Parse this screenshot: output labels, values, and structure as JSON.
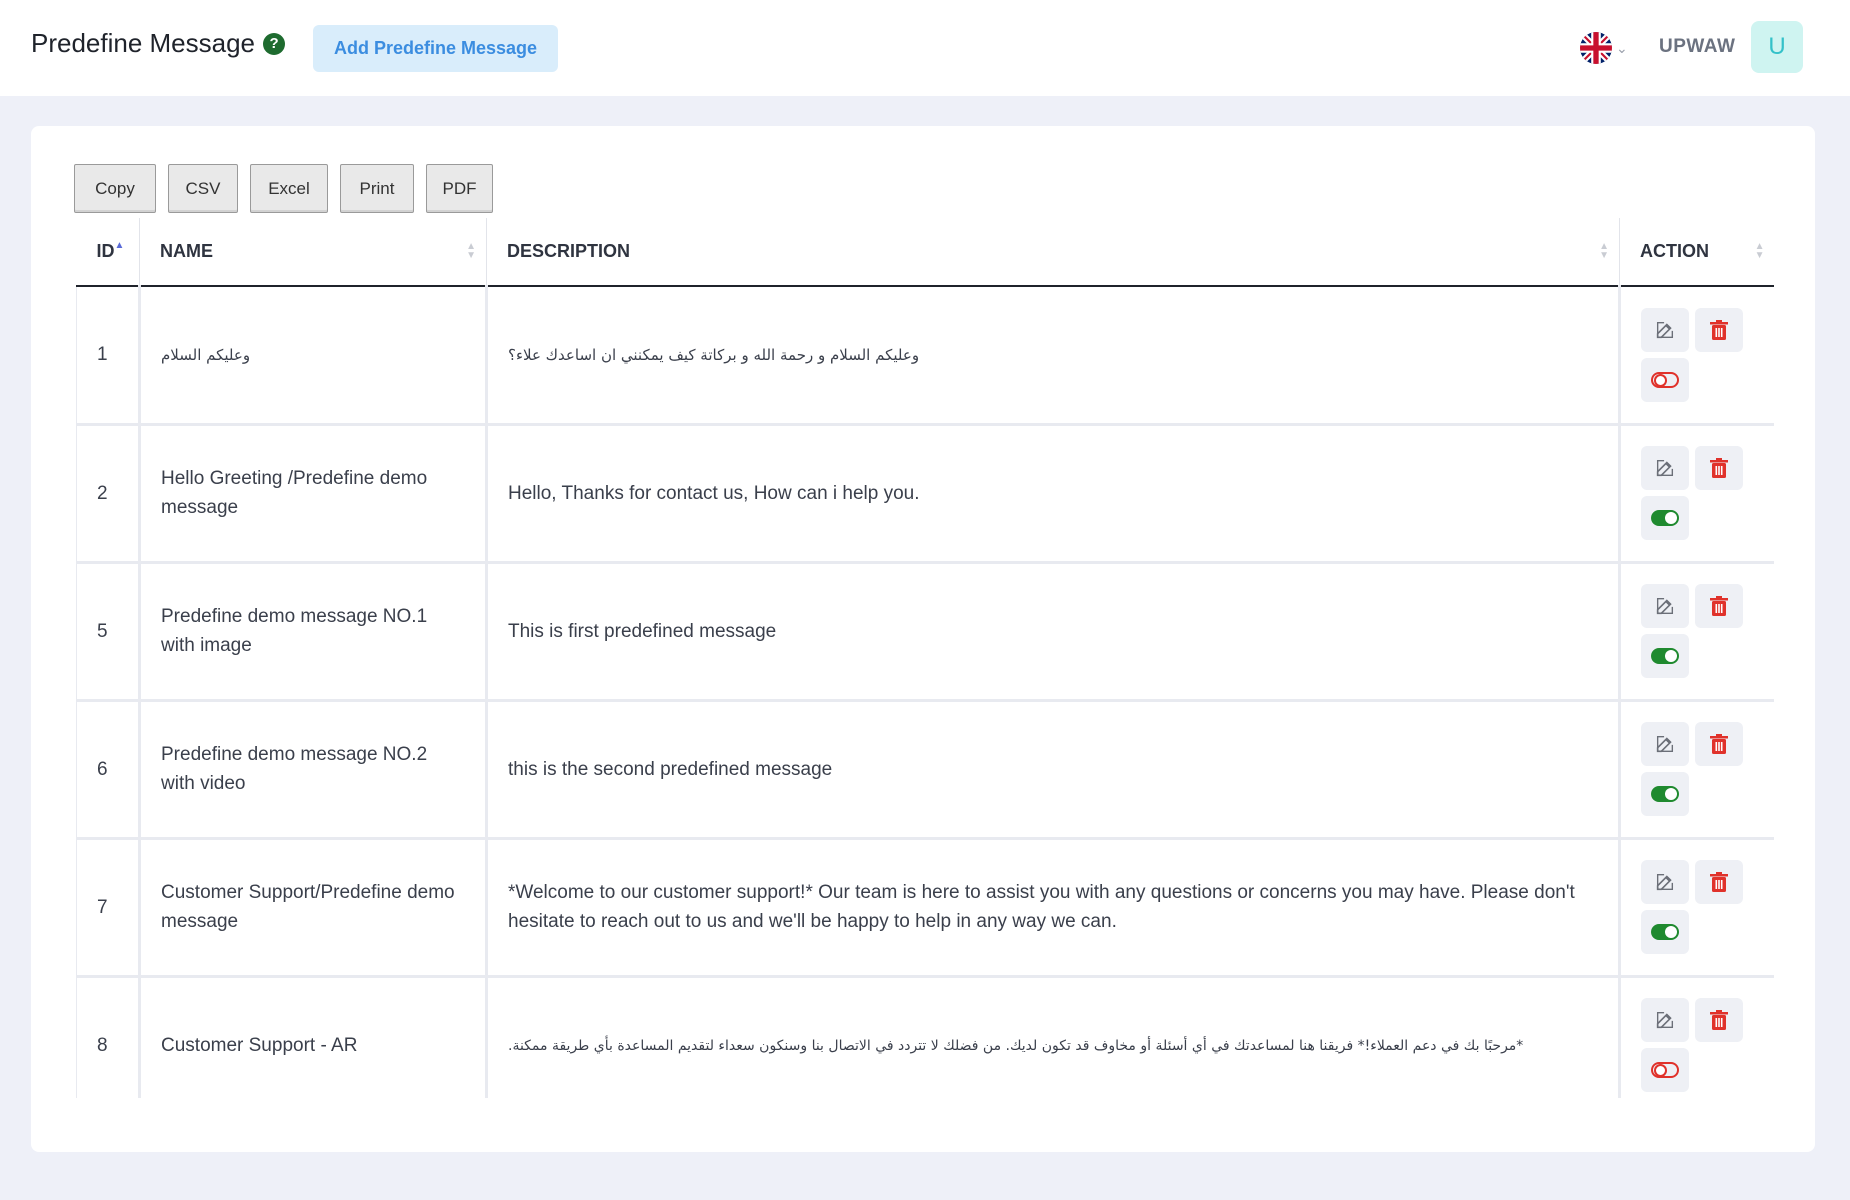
{
  "header": {
    "title": "Predefine Message",
    "help_icon": "question-circle-icon",
    "add_button_label": "Add Predefine Message",
    "language_icon": "uk-flag-icon",
    "username": "UPWAW",
    "avatar_letter": "U"
  },
  "colors": {
    "accent": "#3b8de0",
    "add_button_bg": "#d9edfb",
    "toggle_on": "#1f8a2f",
    "toggle_off": "#e0322b",
    "delete": "#e0322b",
    "avatar_bg": "#cff4f1"
  },
  "export_buttons": [
    "Copy",
    "CSV",
    "Excel",
    "Print",
    "PDF"
  ],
  "table": {
    "columns": [
      "ID",
      "NAME",
      "DESCRIPTION",
      "ACTION"
    ],
    "sorted_column": "ID",
    "rows": [
      {
        "id": "1",
        "name": "وعليكم السلام",
        "description": "وعليكم السلام و رحمة الله و بركاتة كيف يمكنني ان اساعدك علاء؟",
        "status": "off",
        "rtl": true
      },
      {
        "id": "2",
        "name": "Hello Greeting /Predefine demo message",
        "description": "Hello, Thanks for contact us, How can i help you.",
        "status": "on",
        "rtl": false
      },
      {
        "id": "5",
        "name": "Predefine demo message NO.1 with image",
        "description": "This is first predefined message",
        "status": "on",
        "rtl": false
      },
      {
        "id": "6",
        "name": "Predefine demo message NO.2 with video",
        "description": "this is the second predefined message",
        "status": "on",
        "rtl": false
      },
      {
        "id": "7",
        "name": "Customer Support/Predefine demo message",
        "description": "*Welcome to our customer support!* Our team is here to assist you with any questions or concerns you may have. Please don't hesitate to reach out to us and we'll be happy to help in any way we can.",
        "status": "on",
        "rtl": false
      },
      {
        "id": "8",
        "name": "Customer Support - AR",
        "description": "*مرحبًا بك في دعم العملاء!* فريقنا هنا لمساعدتك في أي أسئلة أو مخاوف قد تكون لديك. من فضلك لا تتردد في الاتصال بنا وسنكون سعداء لتقديم المساعدة بأي طريقة ممكنة.",
        "status": "off",
        "rtl_desc": true
      }
    ]
  }
}
